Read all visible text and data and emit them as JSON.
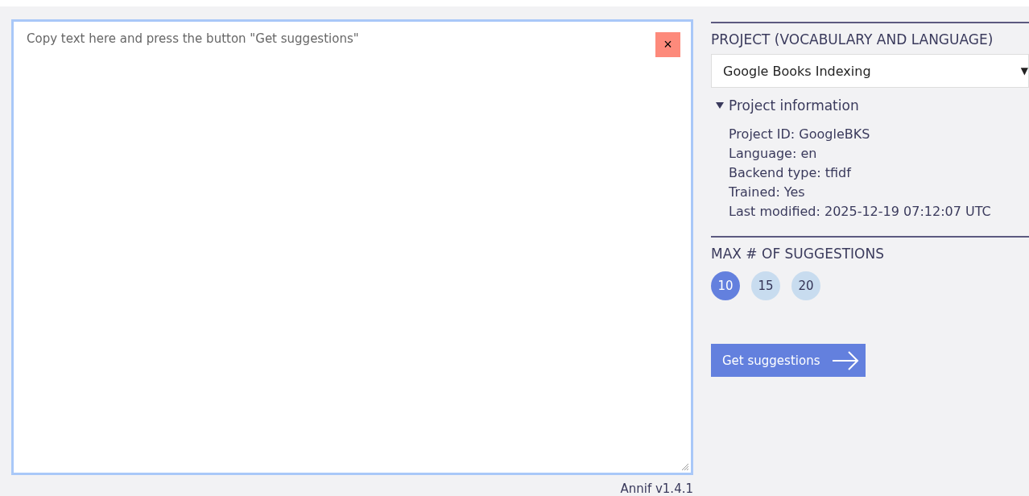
{
  "text_input": {
    "placeholder": "Copy text here and press the button \"Get suggestions\"",
    "clear_button": "×"
  },
  "version": "Annif v1.4.1",
  "project": {
    "heading": "PROJECT (VOCABULARY AND LANGUAGE)",
    "selected_project": "Google Books Indexing",
    "dropdown_arrow": "▼",
    "info": {
      "summary": "Project information",
      "expanded": true,
      "lines": [
        "Project ID: GoogleBKS",
        "Language: en",
        "Backend type: tfidf",
        "Trained: Yes",
        "Last modified: 2025-12-19 07:12:07 UTC"
      ]
    }
  },
  "max_suggestions": {
    "heading": "MAX # OF SUGGESTIONS",
    "options": [
      {
        "label": "10",
        "selected": true
      },
      {
        "label": "15",
        "selected": false
      },
      {
        "label": "20",
        "selected": false
      }
    ]
  },
  "submit_button": "Get suggestions"
}
